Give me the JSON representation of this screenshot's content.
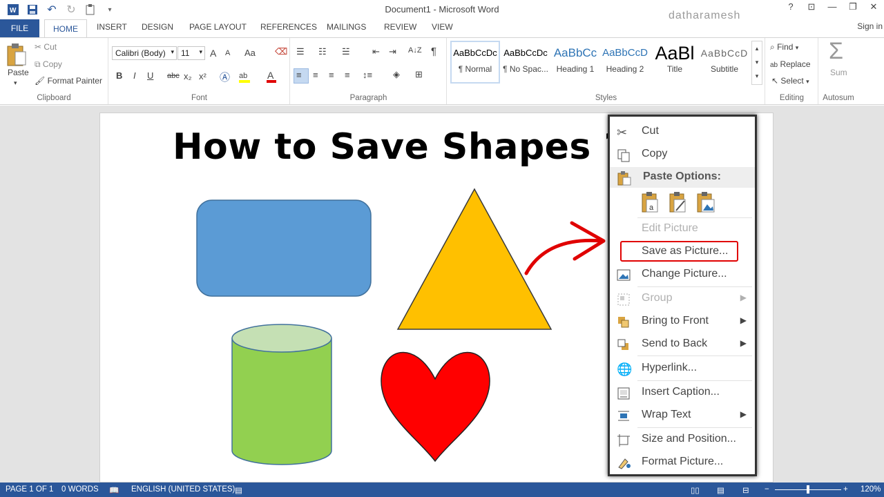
{
  "app": {
    "title": "Document1 - Microsoft Word",
    "watermark": "datharamesh",
    "sign_in": "Sign in",
    "window_controls": [
      "?",
      "⊡",
      "—",
      "❐",
      "✕"
    ]
  },
  "tabs": {
    "file": "FILE",
    "home": "HOME",
    "items": [
      "INSERT",
      "DESIGN",
      "PAGE LAYOUT",
      "REFERENCES",
      "MAILINGS",
      "REVIEW",
      "VIEW"
    ]
  },
  "ribbon": {
    "clipboard": {
      "label": "Clipboard",
      "paste": "Paste",
      "cut": "Cut",
      "copy": "Copy",
      "format_painter": "Format Painter"
    },
    "font": {
      "label": "Font",
      "family": "Calibri (Body)",
      "size": "11",
      "grow": "A",
      "shrink": "A",
      "case": "Aa",
      "bold": "B",
      "italic": "I",
      "underline": "U",
      "strike": "abc",
      "subscript": "x₂",
      "superscript": "x²"
    },
    "paragraph": {
      "label": "Paragraph",
      "sort": "A↓Z",
      "pilcrow": "¶"
    },
    "styles": {
      "label": "Styles",
      "items": [
        {
          "sample": "AaBbCcDc",
          "name": "¶ Normal"
        },
        {
          "sample": "AaBbCcDc",
          "name": "¶ No Spac..."
        },
        {
          "sample": "AaBbCc",
          "name": "Heading 1"
        },
        {
          "sample": "AaBbCcD",
          "name": "Heading 2"
        },
        {
          "sample": "AaBl",
          "name": "Title"
        },
        {
          "sample": "AaBbCcD",
          "name": "Subtitle"
        }
      ]
    },
    "editing": {
      "label": "Editing",
      "find": "Find",
      "replace": "Replace",
      "select": "Select"
    },
    "autosum": {
      "label": "Autosum",
      "sum": "Sum",
      "sigma": "Σ"
    }
  },
  "document": {
    "heading": "How to Save Shapes ?"
  },
  "context_menu": {
    "cut": "Cut",
    "copy": "Copy",
    "paste_options": "Paste Options:",
    "edit_picture": "Edit Picture",
    "save_as_picture": "Save as Picture...",
    "change_picture": "Change Picture...",
    "group": "Group",
    "bring_to_front": "Bring to Front",
    "send_to_back": "Send to Back",
    "hyperlink": "Hyperlink...",
    "insert_caption": "Insert Caption...",
    "wrap_text": "Wrap Text",
    "size_and_position": "Size and Position...",
    "format_picture": "Format Picture..."
  },
  "status": {
    "page": "PAGE 1 OF 1",
    "words": "0 WORDS",
    "language": "ENGLISH (UNITED STATES)",
    "zoom": "120%"
  },
  "colors": {
    "accent": "#2b579a",
    "rectangle": "#5b9bd5",
    "triangle": "#ffc000",
    "cylinder": "#92d050",
    "cylinder_top": "#c5e0b4",
    "heart": "#ff0000",
    "highlight": "#e00000"
  }
}
